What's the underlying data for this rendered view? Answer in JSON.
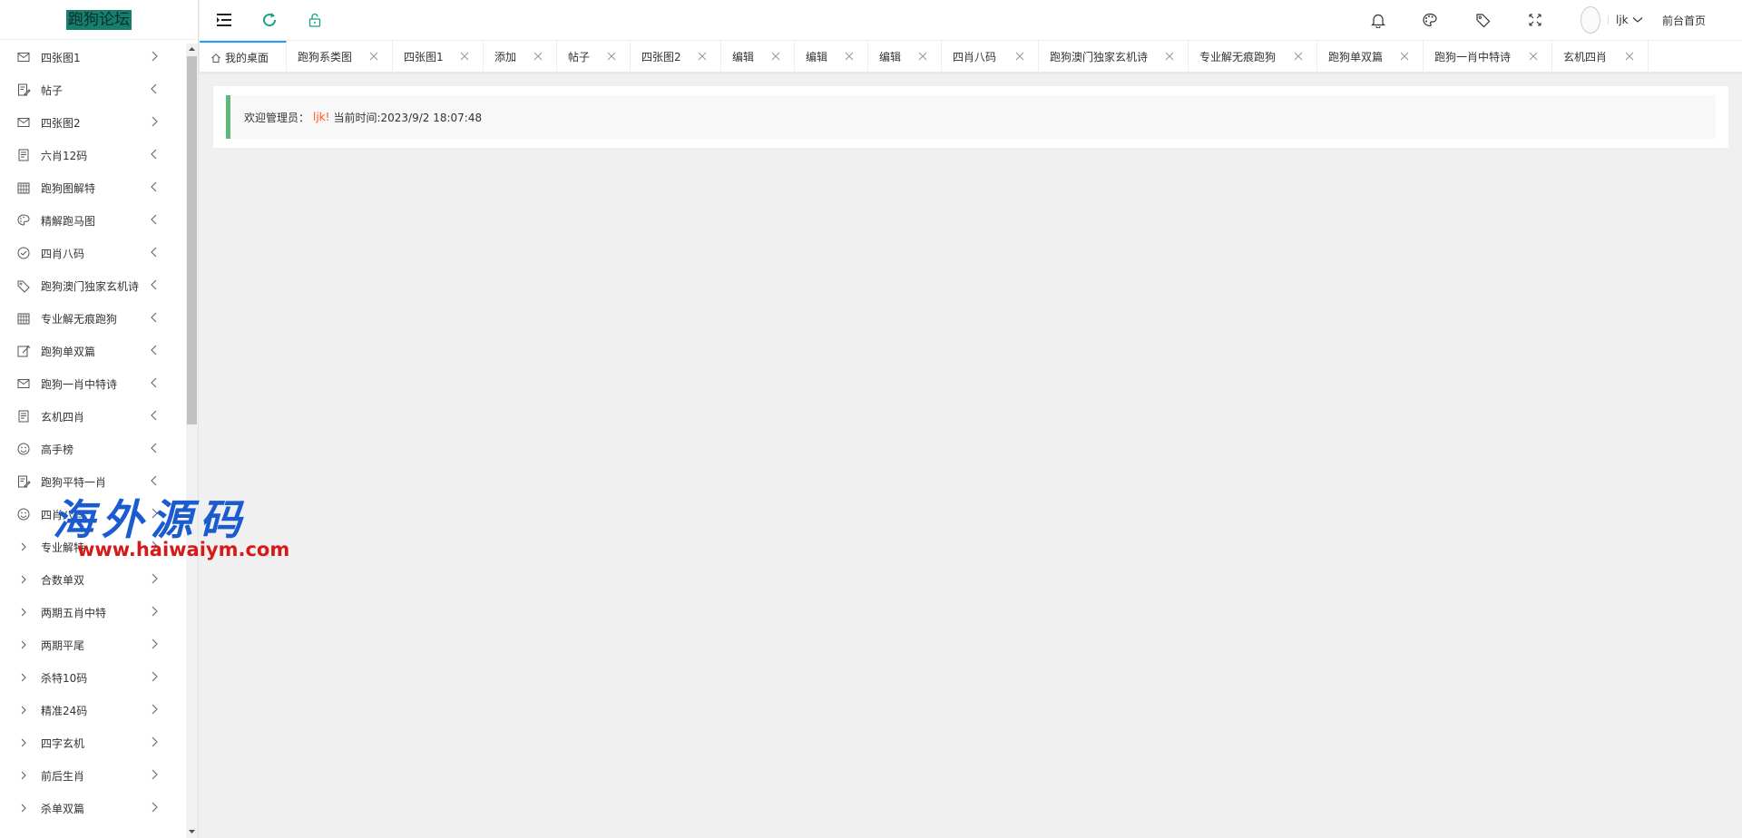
{
  "app": {
    "logo_text": "跑狗论坛"
  },
  "sidebar": {
    "items": [
      {
        "label": "四张图1",
        "icon": "mail-icon",
        "arrow": "right"
      },
      {
        "label": "帖子",
        "icon": "note-edit-icon",
        "arrow": "left"
      },
      {
        "label": "四张图2",
        "icon": "mail-icon",
        "arrow": "right"
      },
      {
        "label": "六肖12码",
        "icon": "list-doc-icon",
        "arrow": "left"
      },
      {
        "label": "跑狗图解特",
        "icon": "calendar-grid-icon",
        "arrow": "left"
      },
      {
        "label": "精解跑马图",
        "icon": "palette-icon",
        "arrow": "left"
      },
      {
        "label": "四肖八码",
        "icon": "check-circle-icon",
        "arrow": "left"
      },
      {
        "label": "跑狗澳门独家玄机诗",
        "icon": "tag-icon",
        "arrow": "left"
      },
      {
        "label": "专业解无痕跑狗",
        "icon": "calendar-grid-icon",
        "arrow": "left"
      },
      {
        "label": "跑狗单双篇",
        "icon": "edit-icon",
        "arrow": "left"
      },
      {
        "label": "跑狗一肖中特诗",
        "icon": "mail-icon",
        "arrow": "left"
      },
      {
        "label": "玄机四肖",
        "icon": "list-doc-icon",
        "arrow": "left"
      },
      {
        "label": "高手榜",
        "icon": "smile-icon",
        "arrow": "left"
      },
      {
        "label": "跑狗平特一肖",
        "icon": "note-edit-icon",
        "arrow": "left"
      },
      {
        "label": "四肖八码",
        "icon": "smile-icon",
        "arrow": "right"
      },
      {
        "label": "专业解特",
        "icon": "chevron-right-icon",
        "arrow": "right"
      },
      {
        "label": "合数单双",
        "icon": "chevron-right-icon",
        "arrow": "right"
      },
      {
        "label": "两期五肖中特",
        "icon": "chevron-right-icon",
        "arrow": "right"
      },
      {
        "label": "两期平尾",
        "icon": "chevron-right-icon",
        "arrow": "right"
      },
      {
        "label": "杀特10码",
        "icon": "chevron-right-icon",
        "arrow": "right"
      },
      {
        "label": "精准24码",
        "icon": "chevron-right-icon",
        "arrow": "right"
      },
      {
        "label": "四字玄机",
        "icon": "chevron-right-icon",
        "arrow": "right"
      },
      {
        "label": "前后生肖",
        "icon": "chevron-right-icon",
        "arrow": "right"
      },
      {
        "label": "杀单双篇",
        "icon": "chevron-right-icon",
        "arrow": "right"
      }
    ]
  },
  "header": {
    "icons": [
      "menu-toggle-icon",
      "refresh-icon",
      "lock-icon",
      "bell-icon",
      "palette-icon",
      "tag-icon",
      "fullscreen-icon"
    ],
    "username": "ljk",
    "frontpage_label": "前台首页"
  },
  "tabs": [
    {
      "label": "我的桌面",
      "home": true
    },
    {
      "label": "跑狗系类图"
    },
    {
      "label": "四张图1"
    },
    {
      "label": "添加"
    },
    {
      "label": "帖子"
    },
    {
      "label": "四张图2"
    },
    {
      "label": "编辑"
    },
    {
      "label": "编辑"
    },
    {
      "label": "编辑"
    },
    {
      "label": "四肖八码"
    },
    {
      "label": "跑狗澳门独家玄机诗"
    },
    {
      "label": "专业解无痕跑狗"
    },
    {
      "label": "跑狗单双篇"
    },
    {
      "label": "跑狗一肖中特诗"
    },
    {
      "label": "玄机四肖"
    }
  ],
  "welcome": {
    "prefix": "欢迎管理员：",
    "username": "ljk!",
    "time_label": "当前时间:2023/9/2 18:07:48"
  },
  "watermark": {
    "title": "海外源码",
    "url": "www.haiwaiym.com"
  },
  "colors": {
    "accent": "#1e9fff",
    "welcome_bar": "#5fb878",
    "username": "#ff5722",
    "logo_bg": "#167e6c",
    "refresh": "#16a085"
  }
}
